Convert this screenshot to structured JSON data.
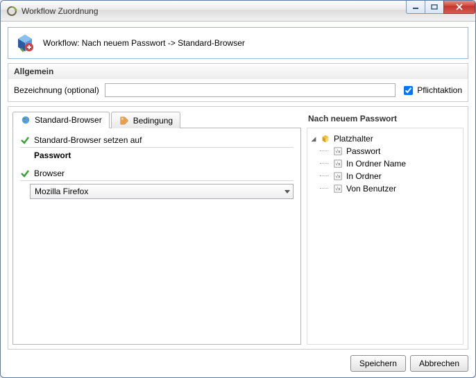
{
  "window": {
    "title": "Workflow Zuordnung"
  },
  "header": {
    "workflow_label": "Workflow: Nach neuem Passwort -> Standard-Browser"
  },
  "general": {
    "heading": "Allgemein",
    "name_label": "Bezeichnung (optional)",
    "name_value": "",
    "mandatory_label": "Pflichtaktion",
    "mandatory_checked": true
  },
  "tabs": {
    "tab1_label": "Standard-Browser",
    "tab2_label": "Bedingung",
    "active_index": 0
  },
  "action": {
    "set_browser_label": "Standard-Browser setzen auf",
    "set_browser_value": "Passwort",
    "browser_label": "Browser",
    "browser_selected": "Mozilla Firefox"
  },
  "right": {
    "title": "Nach neuem Passwort",
    "root_label": "Platzhalter",
    "items": [
      "Passwort",
      "In Ordner Name",
      "In Ordner",
      "Von Benutzer"
    ]
  },
  "footer": {
    "save": "Speichern",
    "cancel": "Abbrechen"
  },
  "icons": {
    "app": "gear-recycle-icon",
    "cube": "workflow-cube-icon",
    "globe": "globe-icon",
    "cond": "tag-icon",
    "check": "green-check-icon",
    "folder": "yellow-cube-icon",
    "leaf": "variable-icon"
  }
}
